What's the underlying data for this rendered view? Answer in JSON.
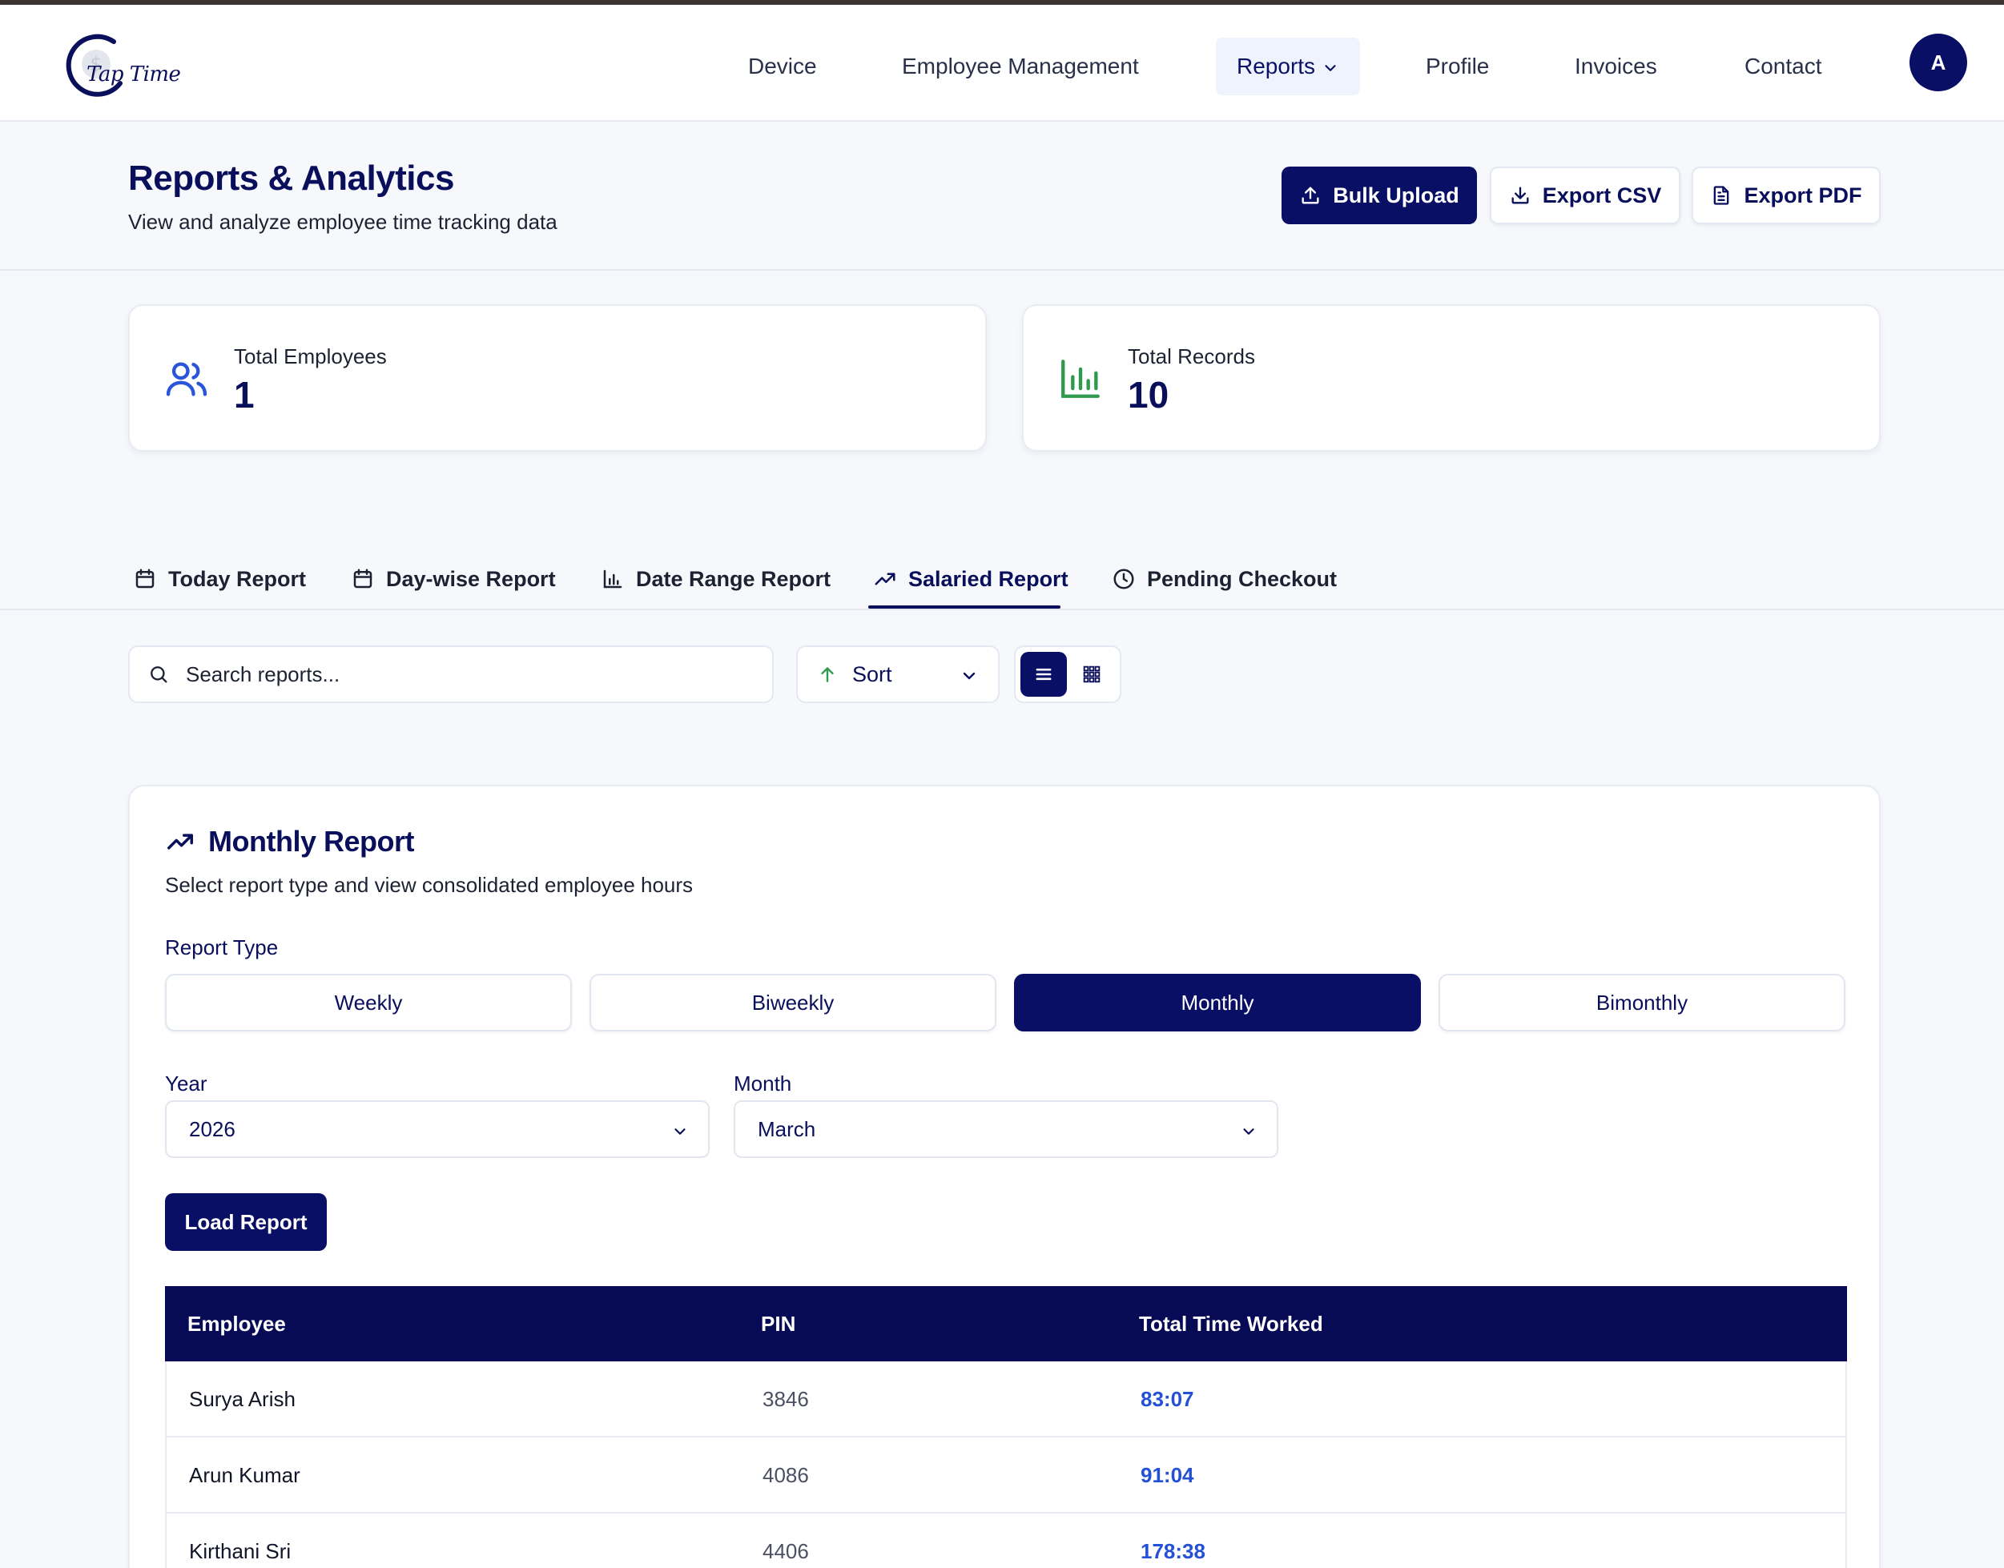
{
  "app": {
    "logo_text": "Tap Time"
  },
  "nav": {
    "items": [
      {
        "label": "Device"
      },
      {
        "label": "Employee Management"
      },
      {
        "label": "Reports"
      },
      {
        "label": "Profile"
      },
      {
        "label": "Invoices"
      },
      {
        "label": "Contact"
      }
    ],
    "active": "Reports",
    "avatar_initial": "A"
  },
  "header": {
    "title": "Reports & Analytics",
    "subtitle": "View and analyze employee time tracking data",
    "buttons": {
      "bulk_upload": "Bulk Upload",
      "export_csv": "Export CSV",
      "export_pdf": "Export PDF"
    }
  },
  "stats": [
    {
      "label": "Total Employees",
      "value": "1",
      "icon": "users-icon",
      "color": "#2a55d8"
    },
    {
      "label": "Total Records",
      "value": "10",
      "icon": "bar-chart-icon",
      "color": "#2e9a4c"
    }
  ],
  "tabs": [
    {
      "label": "Today Report",
      "icon": "calendar-icon"
    },
    {
      "label": "Day-wise Report",
      "icon": "calendar-icon"
    },
    {
      "label": "Date Range Report",
      "icon": "bar-chart-icon"
    },
    {
      "label": "Salaried Report",
      "icon": "trending-up-icon"
    },
    {
      "label": "Pending Checkout",
      "icon": "clock-icon"
    }
  ],
  "active_tab": "Salaried Report",
  "toolbar": {
    "search_placeholder": "Search reports...",
    "sort_label": "Sort",
    "view_mode": "list"
  },
  "report": {
    "title": "Monthly Report",
    "description": "Select report type and view consolidated employee hours",
    "type_label": "Report Type",
    "types": [
      "Weekly",
      "Biweekly",
      "Monthly",
      "Bimonthly"
    ],
    "selected_type": "Monthly",
    "year_label": "Year",
    "year_value": "2026",
    "month_label": "Month",
    "month_value": "March",
    "load_button": "Load Report",
    "table": {
      "columns": [
        "Employee",
        "PIN",
        "Total Time Worked"
      ],
      "rows": [
        {
          "employee": "Surya Arish",
          "pin": "3846",
          "time": "83:07"
        },
        {
          "employee": "Arun Kumar",
          "pin": "4086",
          "time": "91:04"
        },
        {
          "employee": "Kirthani Sri",
          "pin": "4406",
          "time": "178:38"
        }
      ]
    }
  },
  "colors": {
    "primary": "#0a0f66",
    "accent_blue": "#2450d6",
    "accent_green": "#2e9a4c"
  }
}
